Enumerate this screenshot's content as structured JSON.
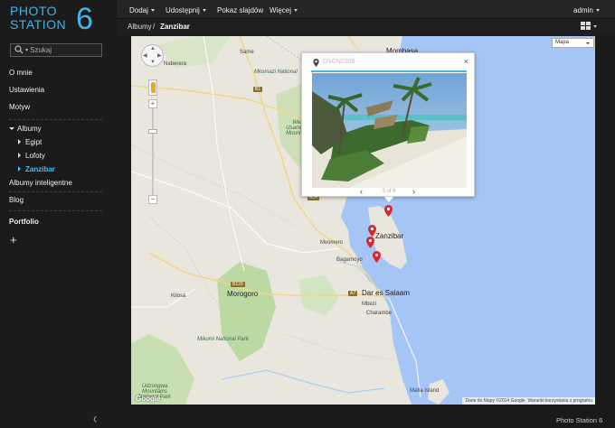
{
  "logo": {
    "line1": "PHOTO",
    "line2": "STATION",
    "number": "6"
  },
  "search": {
    "placeholder": "Szukaj"
  },
  "sidebar": {
    "about": "O mnie",
    "settings": "Ustawienia",
    "theme": "Motyw",
    "albums": "Albumy",
    "albums_children": [
      "Egipt",
      "Lofoty",
      "Zanzibar"
    ],
    "smart_albums": "Albumy inteligentne",
    "blog": "Blog",
    "portfolio": "Portfolio",
    "add": "+"
  },
  "topmenu": {
    "add": "Dodaj",
    "share": "Udostępnij",
    "slideshow": "Pokaz slajdów",
    "more": "Więcej",
    "user": "admin"
  },
  "breadcrumb": {
    "root": "Albumy",
    "sep": "/",
    "current": "Zanzibar"
  },
  "map": {
    "type_select": "Mapa",
    "attribution_data": "Dane do Mapy ©2014 Google",
    "attribution_terms": "Warunki korzystania z programu",
    "google": "Google",
    "labels": {
      "same": "Same",
      "mombasa": "Mombasa",
      "naberera": "Naberera",
      "mkomazi": "Mkomazi National",
      "usambara": "West Usambara Mountains",
      "zanzibar": "Zanzibar",
      "mvomero": "Mvomero",
      "bagamoyo": "Bagamoyo",
      "dar": "Dar es Salaam",
      "kilosa": "Kilosa",
      "morogoro": "Morogoro",
      "mikumi": "Mikumi National Park",
      "udzungwa": "Udzungwa Mountains National Park",
      "mbezi": "Mbezi",
      "charambe": "Charambe",
      "mafia": "Mafia Island",
      "r_b1": "B1",
      "r_a14": "A14",
      "r_b129": "B129",
      "r_a7": "A7"
    }
  },
  "popup": {
    "filename": "DSCN0309",
    "counter": "3 of 6",
    "close": "×",
    "prev": "‹",
    "next": "›"
  },
  "footer": {
    "app_name": "Photo Station 6"
  },
  "colors": {
    "accent": "#42b4e6",
    "water": "#a4c5f5",
    "pin": "#d8282f"
  }
}
